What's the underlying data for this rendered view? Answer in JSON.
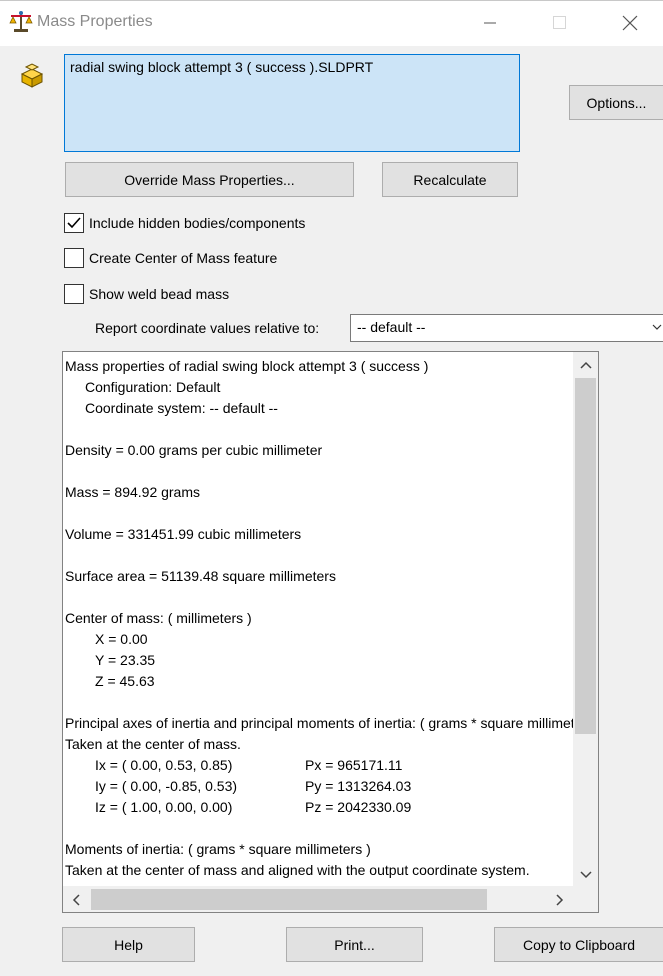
{
  "window": {
    "title": "Mass Properties",
    "icons": {
      "app": "balance-scale-icon",
      "minimize": "minimize-icon",
      "maximize": "maximize-icon",
      "close": "close-icon"
    }
  },
  "part": {
    "icon": "part-block-icon",
    "name": "radial swing block attempt 3 ( success ).SLDPRT"
  },
  "buttons": {
    "options": "Options...",
    "override": "Override Mass Properties...",
    "recalculate": "Recalculate",
    "help": "Help",
    "print": "Print...",
    "copy": "Copy to Clipboard"
  },
  "checkboxes": [
    {
      "label": "Include hidden bodies/components",
      "checked": true
    },
    {
      "label": "Create Center of Mass feature",
      "checked": false
    },
    {
      "label": "Show weld bead mass",
      "checked": false
    }
  ],
  "coordinate": {
    "label": "Report coordinate values relative to:",
    "value": "-- default --"
  },
  "results": {
    "header": "Mass properties of radial swing block attempt 3 ( success )",
    "configuration": "Configuration: Default",
    "coord_system": "Coordinate system: -- default --",
    "density": "Density = 0.00 grams per cubic millimeter",
    "mass": "Mass = 894.92 grams",
    "volume": "Volume = 331451.99 cubic millimeters",
    "surface_area": "Surface area = 51139.48  square millimeters",
    "com_header": "Center of mass: ( millimeters )",
    "com_x": "X = 0.00",
    "com_y": "Y = 23.35",
    "com_z": "Z = 45.63",
    "principal_header": "Principal axes of inertia and principal moments of inertia: ( grams *  square millimeters )",
    "principal_sub": "Taken at the center of mass.",
    "axes": [
      {
        "axis": "Ix = ( 0.00,  0.53,  0.85)",
        "moment": "Px = 965171.11"
      },
      {
        "axis": "Iy = ( 0.00, -0.85,  0.53)",
        "moment": "Py = 1313264.03"
      },
      {
        "axis": "Iz = ( 1.00,  0.00,  0.00)",
        "moment": "Pz = 2042330.09"
      }
    ],
    "moi_header": "Moments of inertia: ( grams *  square millimeters )",
    "moi_sub": "Taken at the center of mass and aligned with the output coordinate system."
  },
  "colors": {
    "selection": "#cce4f7",
    "selection_border": "#0078d7",
    "button_face": "#e1e1e1",
    "dialog_bg": "#f0f0f0"
  }
}
